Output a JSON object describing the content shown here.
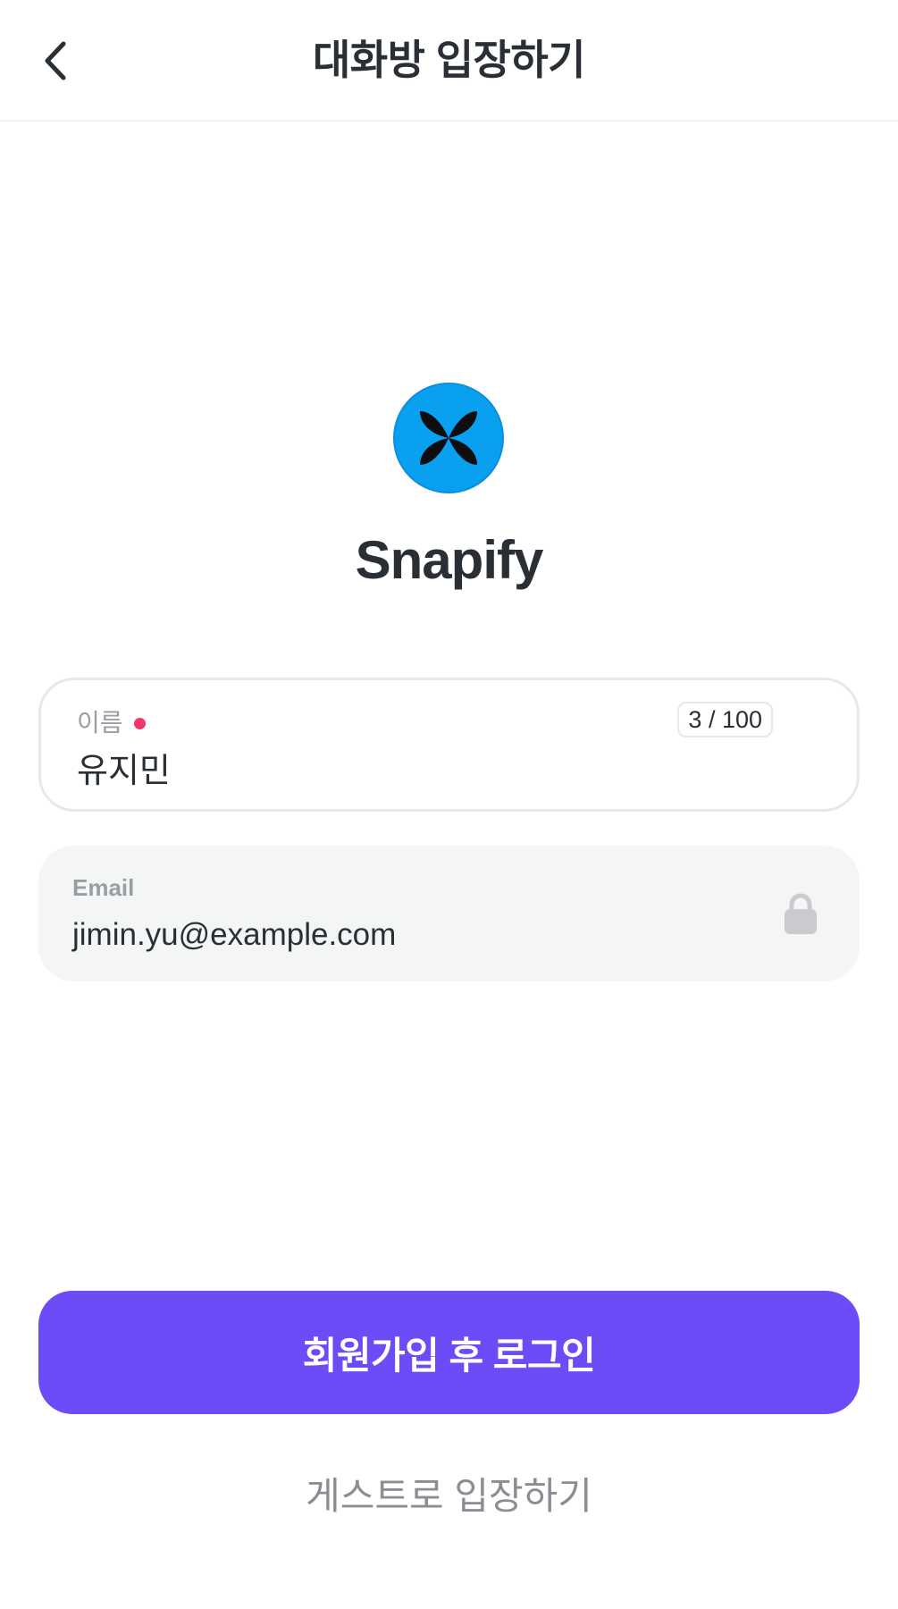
{
  "header": {
    "title": "대화방 입장하기",
    "back_icon": "chevron-left-icon"
  },
  "brand": {
    "name": "Snapify",
    "logo_icon": "butterfly-logo-icon",
    "logo_color": "#0aa0f0"
  },
  "name_field": {
    "label": "이름",
    "value": "유지민",
    "char_count": "3 / 100",
    "required": true
  },
  "email_field": {
    "label": "Email",
    "value": "jimin.yu@example.com",
    "lock_icon": "lock-icon"
  },
  "actions": {
    "signup_login_label": "회원가입 후 로그인",
    "guest_label": "게스트로 입장하기"
  },
  "colors": {
    "primary": "#6b4cf6",
    "required_dot": "#f0386b",
    "text": "#2a2e35",
    "muted": "#9a9ea4"
  }
}
